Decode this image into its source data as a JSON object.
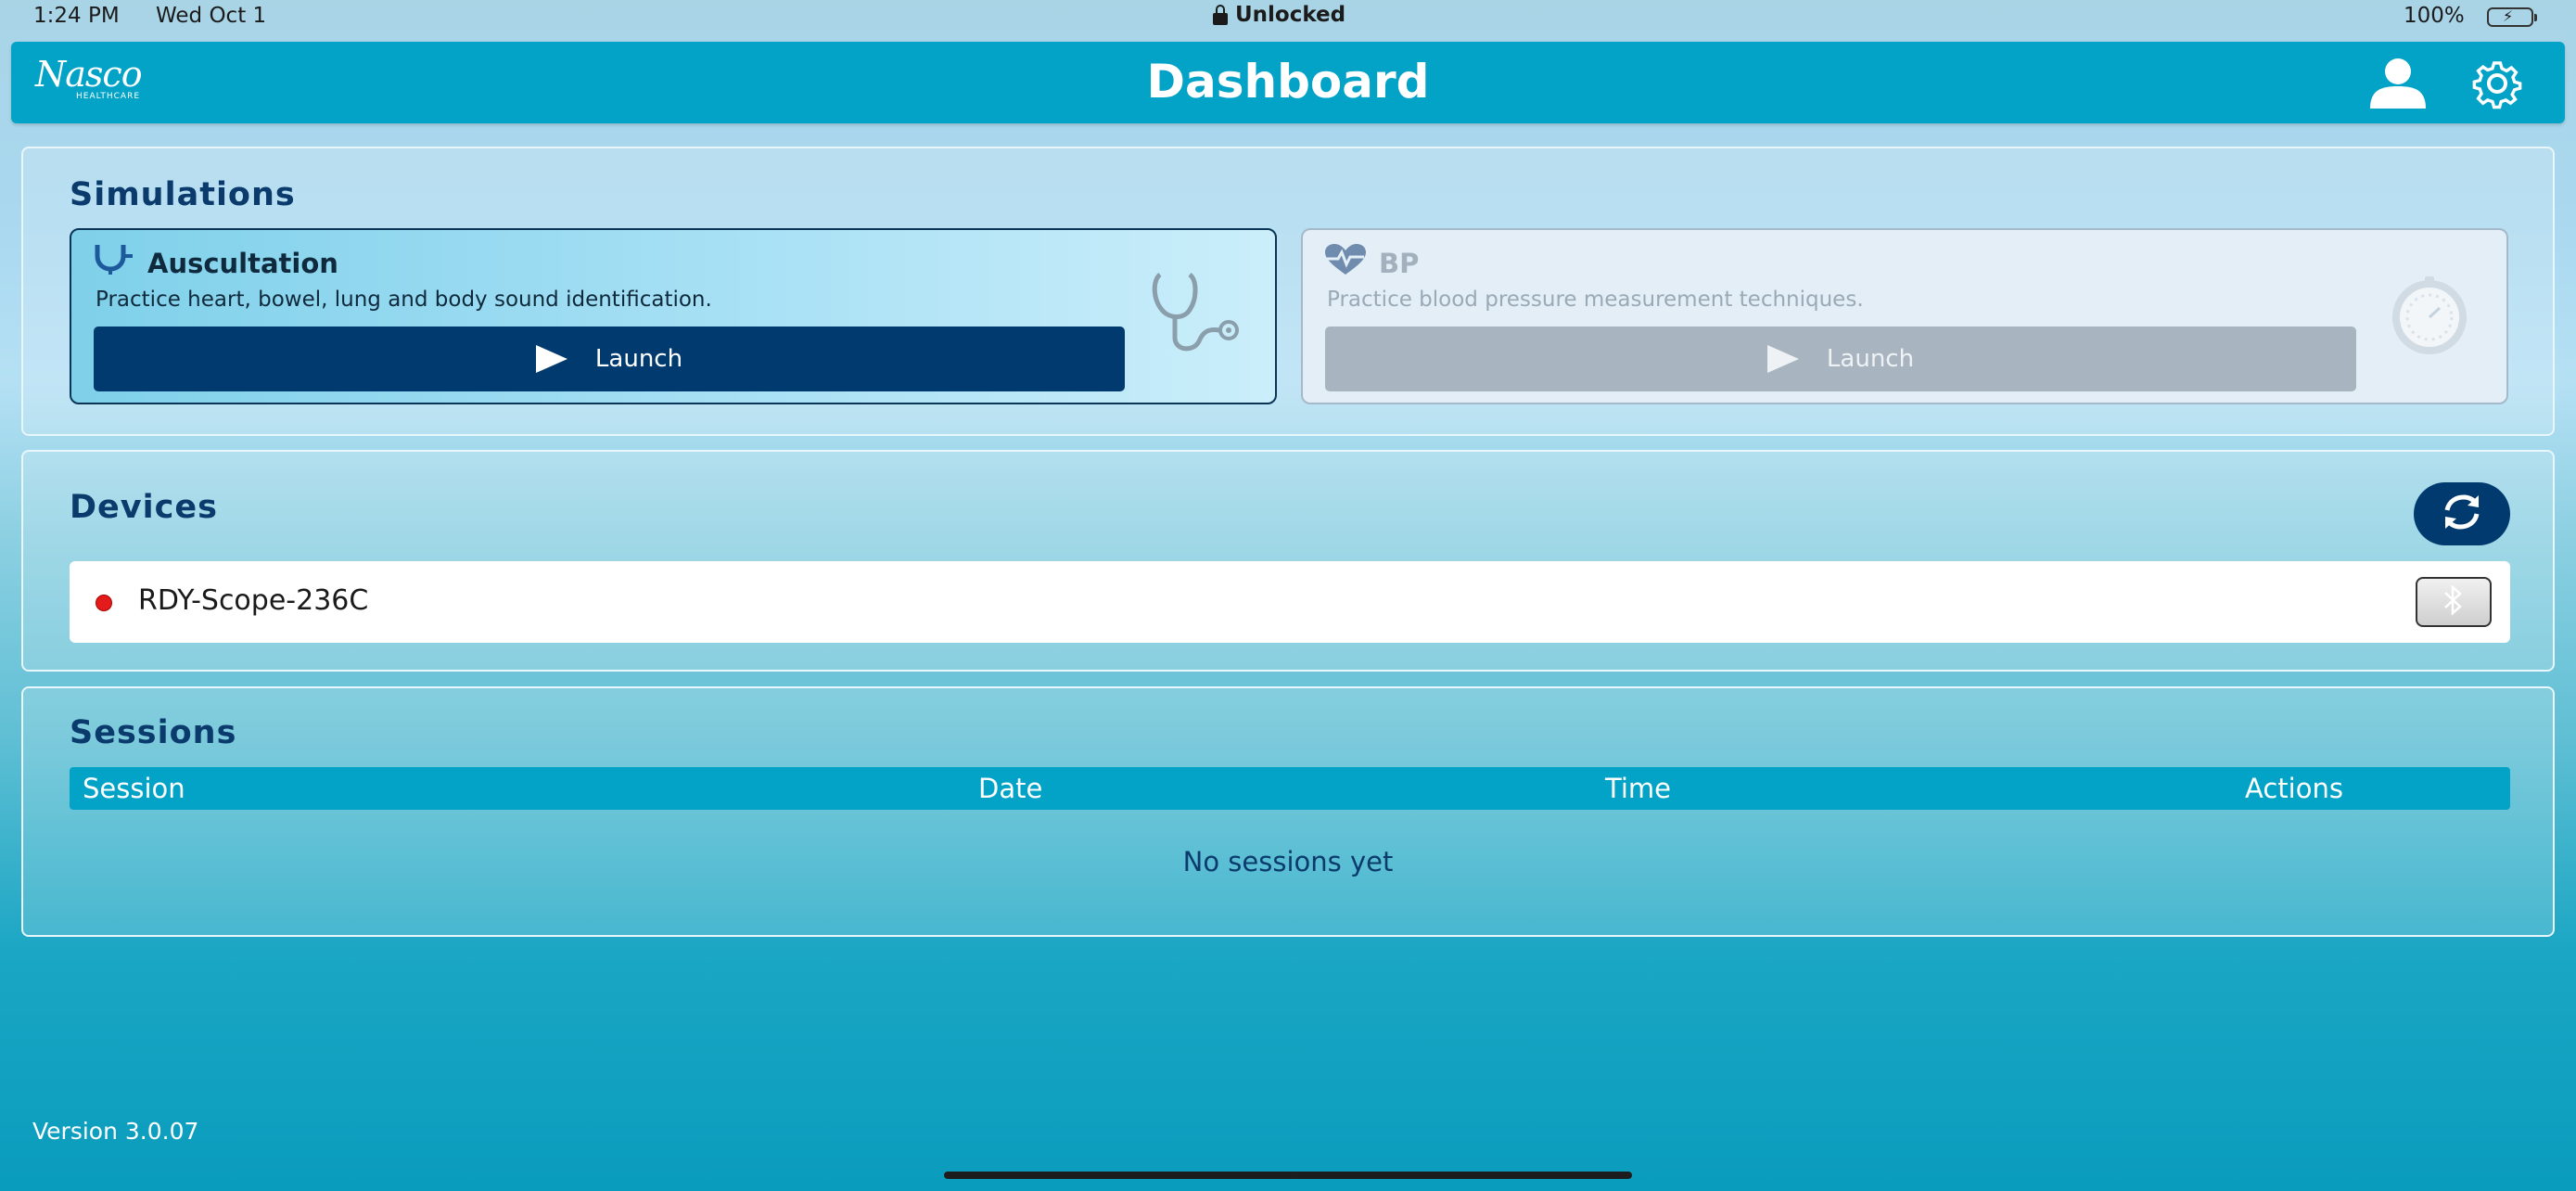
{
  "status_bar": {
    "time": "1:24 PM",
    "date": "Wed Oct 1",
    "lock_label": "Unlocked",
    "battery": "100%"
  },
  "header": {
    "logo_text": "Nasco",
    "logo_subtext": "HEALTHCARE",
    "title": "Dashboard",
    "user_icon": "user-icon",
    "settings_icon": "gear-icon"
  },
  "simulations": {
    "title": "Simulations",
    "cards": [
      {
        "name": "Auscultation",
        "description": "Practice heart, bowel, lung and body sound identification.",
        "launch_label": "Launch",
        "icon": "stethoscope-icon",
        "enabled": true
      },
      {
        "name": "BP",
        "description": "Practice blood pressure measurement techniques.",
        "launch_label": "Launch",
        "icon": "heart-pulse-icon",
        "enabled": false
      }
    ]
  },
  "devices": {
    "title": "Devices",
    "refresh_icon": "refresh-icon",
    "items": [
      {
        "name": "RDY-Scope-236C",
        "status_color": "#e31b1b",
        "connect_icon": "bluetooth-icon"
      }
    ]
  },
  "sessions": {
    "title": "Sessions",
    "columns": [
      "Session",
      "Date",
      "Time",
      "Actions"
    ],
    "rows": [],
    "empty_text": "No sessions yet"
  },
  "footer": {
    "version": "Version 3.0.07"
  },
  "colors": {
    "header": "#03a3c7",
    "primary_button": "#003a6f",
    "title_text": "#0a3b6c"
  }
}
